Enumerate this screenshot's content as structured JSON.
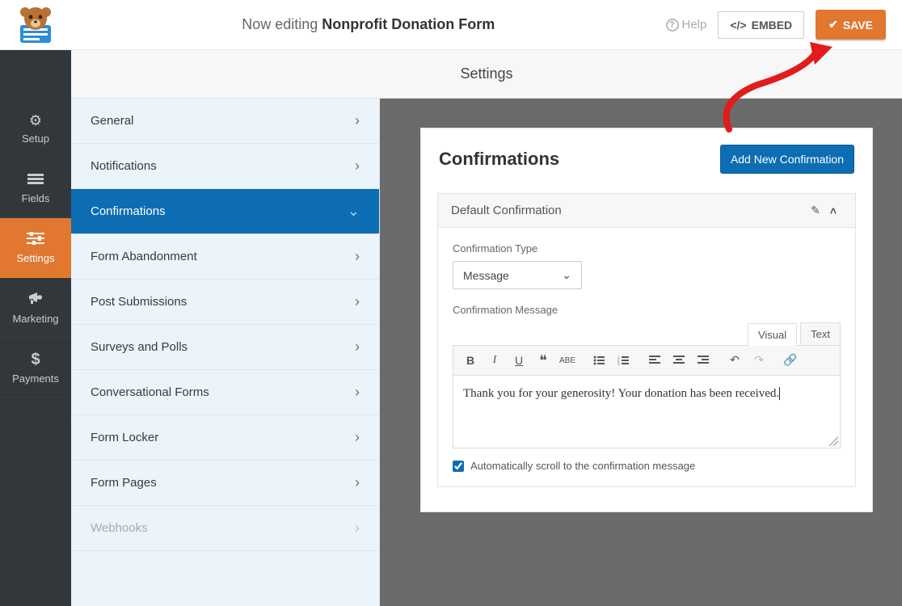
{
  "header": {
    "editing_prefix": "Now editing",
    "form_name": "Nonprofit Donation Form",
    "help_label": "Help",
    "embed_label": "EMBED",
    "save_label": "SAVE"
  },
  "midbar": {
    "label": "Settings"
  },
  "leftnav": [
    {
      "key": "setup",
      "label": "Setup",
      "icon": "⚙"
    },
    {
      "key": "fields",
      "label": "Fields",
      "icon": "☰"
    },
    {
      "key": "settings",
      "label": "Settings",
      "icon": "≡",
      "active": true
    },
    {
      "key": "marketing",
      "label": "Marketing",
      "icon": "📣"
    },
    {
      "key": "payments",
      "label": "Payments",
      "icon": "$"
    }
  ],
  "subnav": [
    {
      "label": "General"
    },
    {
      "label": "Notifications"
    },
    {
      "label": "Confirmations",
      "active": true,
      "expanded": true
    },
    {
      "label": "Form Abandonment"
    },
    {
      "label": "Post Submissions"
    },
    {
      "label": "Surveys and Polls"
    },
    {
      "label": "Conversational Forms"
    },
    {
      "label": "Form Locker"
    },
    {
      "label": "Form Pages"
    },
    {
      "label": "Webhooks",
      "disabled": true
    }
  ],
  "panel": {
    "title": "Confirmations",
    "add_button": "Add New Confirmation",
    "card_title": "Default Confirmation",
    "type_label": "Confirmation Type",
    "type_value": "Message",
    "message_label": "Confirmation Message",
    "tabs": {
      "visual": "Visual",
      "text": "Text",
      "active": "visual"
    },
    "message_value": "Thank you for your generosity! Your donation has been received.",
    "scroll_checkbox_label": "Automatically scroll to the confirmation message",
    "scroll_checked": true
  },
  "colors": {
    "accent": "#e27730",
    "primary": "#0c6db3",
    "subnav_bg": "#ebf3fb"
  }
}
